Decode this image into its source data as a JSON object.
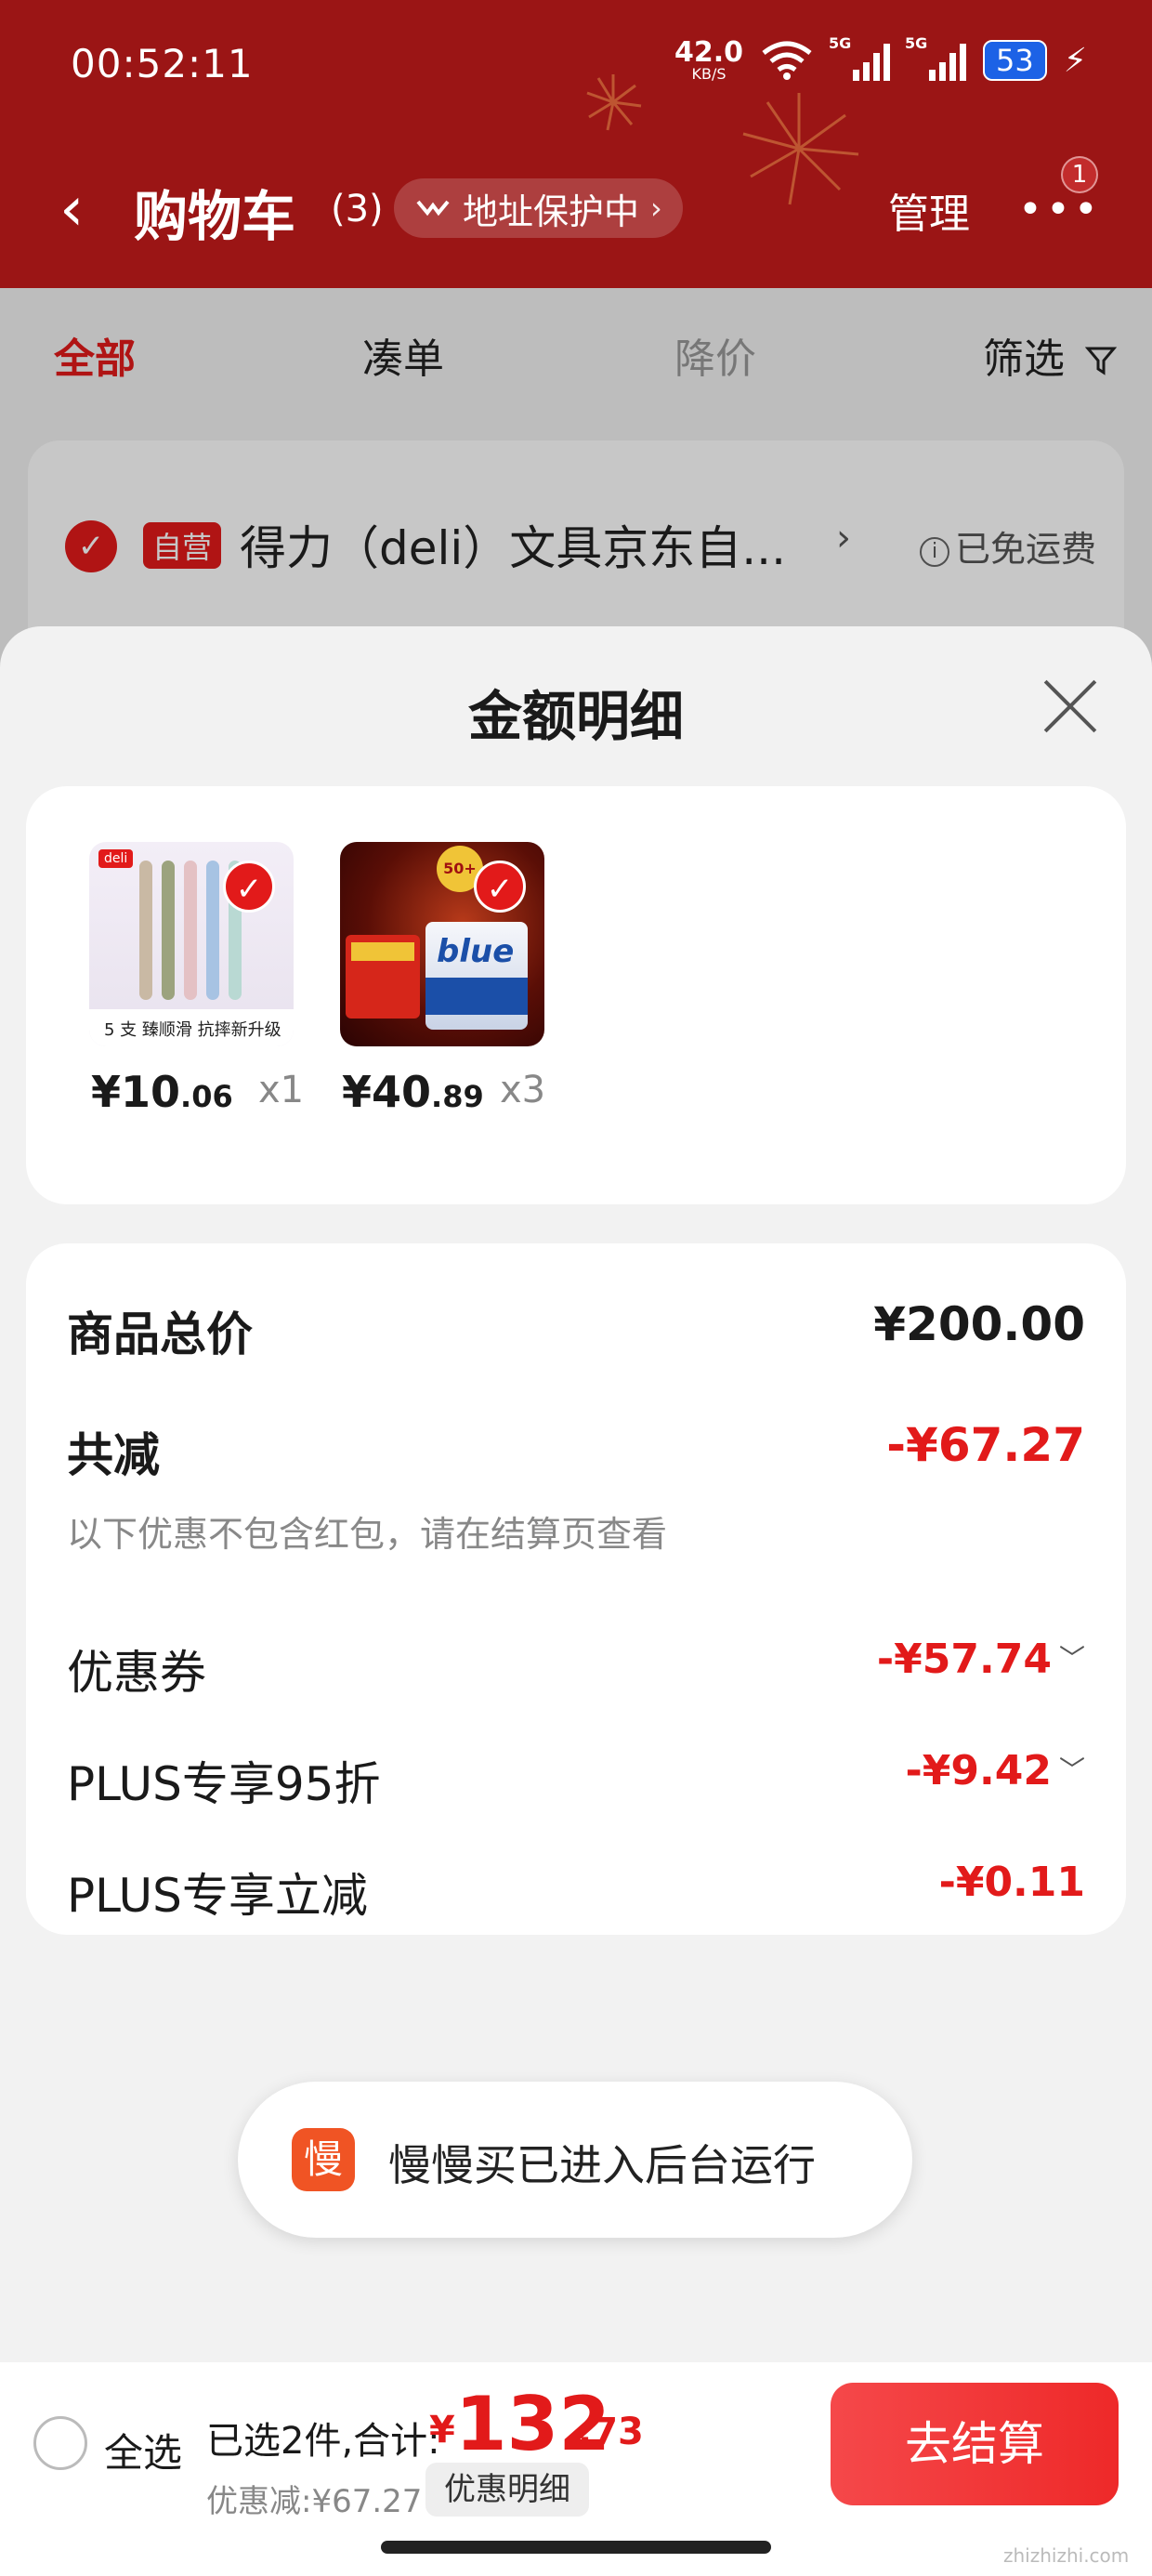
{
  "status_bar": {
    "time": "00:52:11",
    "net_speed": "42.0",
    "net_unit": "KB/S",
    "signal1_label": "5G",
    "signal2_label": "5G",
    "battery": "53",
    "bolt": "⚡"
  },
  "nav": {
    "back_glyph": "‹",
    "title": "购物车",
    "count": "(3)",
    "address_protection": "地址保护中",
    "address_chevron": "›",
    "manage": "管理",
    "more_glyph": "•••",
    "more_badge": "1"
  },
  "tabs": [
    {
      "label": "全部"
    },
    {
      "label": "凑单"
    },
    {
      "label": "降价"
    },
    {
      "label": "筛选"
    }
  ],
  "store": {
    "self_tag": "自营",
    "name": "得力（deli）文具京东自...",
    "chevron": "›",
    "free_shipping": "已免运费"
  },
  "sheet": {
    "title": "金额明细",
    "products": [
      {
        "price_main": "¥10",
        "price_cents": ".06",
        "qty": "x1",
        "thumb_label": "5 支  臻顺滑 抗摔新升级",
        "brand": "deli"
      },
      {
        "price_main": "¥40",
        "price_cents": ".89",
        "qty": "x3",
        "box_word": "blue",
        "badge": "50+"
      }
    ],
    "summary": {
      "total_label": "商品总价",
      "total_value": "¥200.00",
      "reduce_label": "共减",
      "reduce_value": "-¥67.27",
      "reduce_note": "以下优惠不包含红包，请在结算页查看",
      "items": [
        {
          "label": "优惠券",
          "value": "-¥57.74",
          "expand": "﹀"
        },
        {
          "label": "PLUS专享95折",
          "value": "-¥9.42",
          "expand": "﹀"
        },
        {
          "label": "PLUS专享立减",
          "value": "-¥0.11",
          "expand": ""
        }
      ]
    }
  },
  "toast": {
    "icon_char": "慢",
    "text": "慢慢买已进入后台运行"
  },
  "bottom_bar": {
    "select_all": "全选",
    "selected_summary": "已选2件,合计:",
    "currency": "¥",
    "total_int": "132",
    "total_dec": ".73",
    "discount": "优惠减:¥67.27",
    "discount_detail": "优惠明细",
    "checkout": "去结算",
    "watermark": "zhizhizhi.com"
  },
  "colors": {
    "header_red": "#9b1515",
    "accent_red": "#e21a1a",
    "checkout_red": "#f5484a"
  }
}
